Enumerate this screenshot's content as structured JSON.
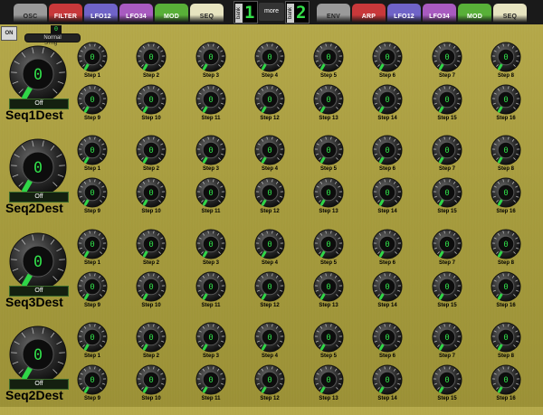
{
  "tabs_left": [
    {
      "label": "OSC",
      "color": "#9a9a9a",
      "text": "light"
    },
    {
      "label": "FILTER",
      "color": "#c8383a",
      "text": "dark"
    },
    {
      "label": "LFO12",
      "color": "#6f63c8",
      "text": "dark"
    },
    {
      "label": "LFO34",
      "color": "#a85ac0",
      "text": "dark"
    },
    {
      "label": "MOD",
      "color": "#58b038",
      "text": "dark"
    },
    {
      "label": "SEQ",
      "color": "#e7e4c0",
      "text": "light"
    }
  ],
  "tabs_right": [
    {
      "label": "ENV",
      "color": "#9a9a9a",
      "text": "light"
    },
    {
      "label": "ARP",
      "color": "#c8383a",
      "text": "dark"
    },
    {
      "label": "LFO12",
      "color": "#6f63c8",
      "text": "dark"
    },
    {
      "label": "LFO34",
      "color": "#a85ac0",
      "text": "dark"
    },
    {
      "label": "MOD",
      "color": "#58b038",
      "text": "dark"
    },
    {
      "label": "SEQ",
      "color": "#e7e4c0",
      "text": "light"
    }
  ],
  "bank_left": {
    "label": "bank",
    "value": "1"
  },
  "bank_right": {
    "label": "bank",
    "value": "2"
  },
  "more_label": "more",
  "on_label": "ON",
  "trig": {
    "value": "0",
    "mode": "Normal",
    "label": "STrig"
  },
  "accent_green": "#31e04a",
  "sections": [
    {
      "dest": "Seq1Dest",
      "dest_value": "0",
      "off_label": "Off",
      "steps": [
        "0",
        "0",
        "0",
        "0",
        "0",
        "0",
        "0",
        "0",
        "0",
        "0",
        "0",
        "0",
        "0",
        "0",
        "0",
        "0"
      ]
    },
    {
      "dest": "Seq2Dest",
      "dest_value": "0",
      "off_label": "Off",
      "steps": [
        "0",
        "0",
        "0",
        "0",
        "0",
        "0",
        "0",
        "0",
        "0",
        "0",
        "0",
        "0",
        "0",
        "0",
        "0",
        "0"
      ]
    },
    {
      "dest": "Seq3Dest",
      "dest_value": "0",
      "off_label": "Off",
      "steps": [
        "0",
        "0",
        "0",
        "0",
        "0",
        "0",
        "0",
        "0",
        "0",
        "0",
        "0",
        "0",
        "0",
        "0",
        "0",
        "0"
      ]
    },
    {
      "dest": "Seq2Dest",
      "dest_value": "0",
      "off_label": "Off",
      "steps": [
        "0",
        "0",
        "0",
        "0",
        "0",
        "0",
        "0",
        "0",
        "0",
        "0",
        "0",
        "0",
        "0",
        "0",
        "0",
        "0"
      ]
    }
  ],
  "step_labels": [
    "Step 1",
    "Step 2",
    "Step 3",
    "Step 4",
    "Step 5",
    "Step 6",
    "Step 7",
    "Step 8",
    "Step 9",
    "Step 10",
    "Step 11",
    "Step 12",
    "Step 13",
    "Step 14",
    "Step 15",
    "Step 16"
  ]
}
